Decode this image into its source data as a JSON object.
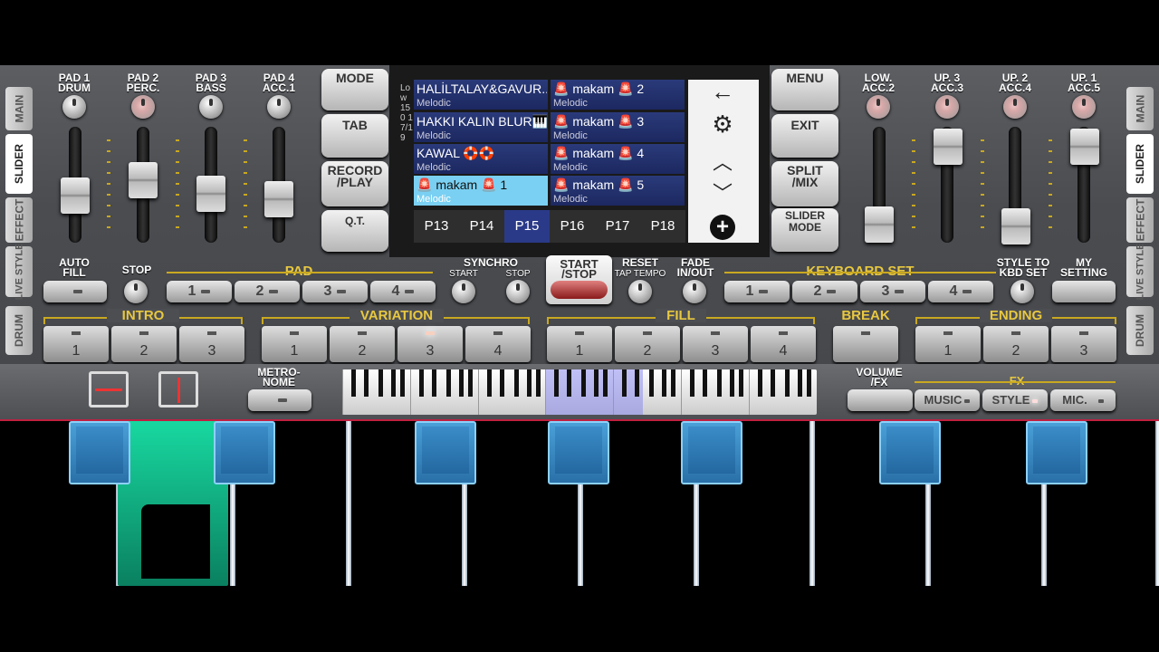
{
  "side_tabs_left": [
    "MAIN",
    "SLIDER",
    "EFFECT",
    "LIVE STYLE",
    "DRUM"
  ],
  "side_tabs_right": [
    "MAIN",
    "SLIDER",
    "EFFECT",
    "LIVE STYLE",
    "DRUM"
  ],
  "pads_left": [
    {
      "label": "PAD 1\nDRUM"
    },
    {
      "label": "PAD 2\nPERC."
    },
    {
      "label": "PAD 3\nBASS"
    },
    {
      "label": "PAD 4\nACC.1"
    }
  ],
  "pads_right": [
    {
      "label": "LOW.\nACC.2"
    },
    {
      "label": "UP. 3\nACC.3"
    },
    {
      "label": "UP. 2\nACC.4"
    },
    {
      "label": "UP. 1\nACC.5"
    }
  ],
  "left_buttons": [
    "MODE",
    "TAB",
    "RECORD\n/PLAY",
    "Q.T."
  ],
  "right_buttons": [
    "MENU",
    "EXIT",
    "SPLIT\n/MIX",
    "SLIDER\nMODE"
  ],
  "screen": {
    "side_label": "Low 150 17/19",
    "cells": [
      {
        "title": "HALİLTALAY&GAVUR..",
        "sub": "Melodic"
      },
      {
        "title": "🚨 makam 🚨 2",
        "sub": "Melodic"
      },
      {
        "title": "HAKKI KALIN BLUR🎹..",
        "sub": "Melodic"
      },
      {
        "title": "🚨 makam 🚨 3",
        "sub": "Melodic"
      },
      {
        "title": "KAWAL 🛟🛟",
        "sub": "Melodic"
      },
      {
        "title": "🚨 makam 🚨 4",
        "sub": "Melodic"
      },
      {
        "title": "🚨 makam 🚨 1",
        "sub": "Melodic"
      },
      {
        "title": "🚨 makam 🚨 5",
        "sub": "Melodic"
      }
    ],
    "pages": [
      "P13",
      "P14",
      "P15",
      "P16",
      "P17",
      "P18"
    ],
    "active_page": "P15"
  },
  "row2": {
    "auto_fill": "AUTO\nFILL",
    "stop": "STOP",
    "pad": "PAD",
    "pad_buttons": [
      "1",
      "2",
      "3",
      "4"
    ],
    "synchro": "SYNCHRO",
    "synchro_start": "START",
    "synchro_stop": "STOP",
    "start_stop": "START\n/STOP",
    "reset": "RESET",
    "tap_tempo": "TAP TEMPO",
    "fade": "FADE\nIN/OUT",
    "keyboard_set": "KEYBOARD SET",
    "kbd_buttons": [
      "1",
      "2",
      "3",
      "4"
    ],
    "style_to_kbd": "STYLE TO\nKBD SET",
    "my_setting": "MY\nSETTING"
  },
  "row3": {
    "intro": "INTRO",
    "intro_buttons": [
      "1",
      "2",
      "3"
    ],
    "variation": "VARIATION",
    "variation_buttons": [
      "1",
      "2",
      "3",
      "4"
    ],
    "fill": "FILL",
    "fill_buttons": [
      "1",
      "2",
      "3",
      "4"
    ],
    "break": "BREAK",
    "ending": "ENDING",
    "ending_buttons": [
      "1",
      "2",
      "3"
    ]
  },
  "row4": {
    "metronome": "METRO-\nNOME",
    "volume_fx": "VOLUME\n/FX",
    "fx": "FX",
    "music": "MUSIC",
    "style": "STYLE",
    "mic": "MIC."
  }
}
